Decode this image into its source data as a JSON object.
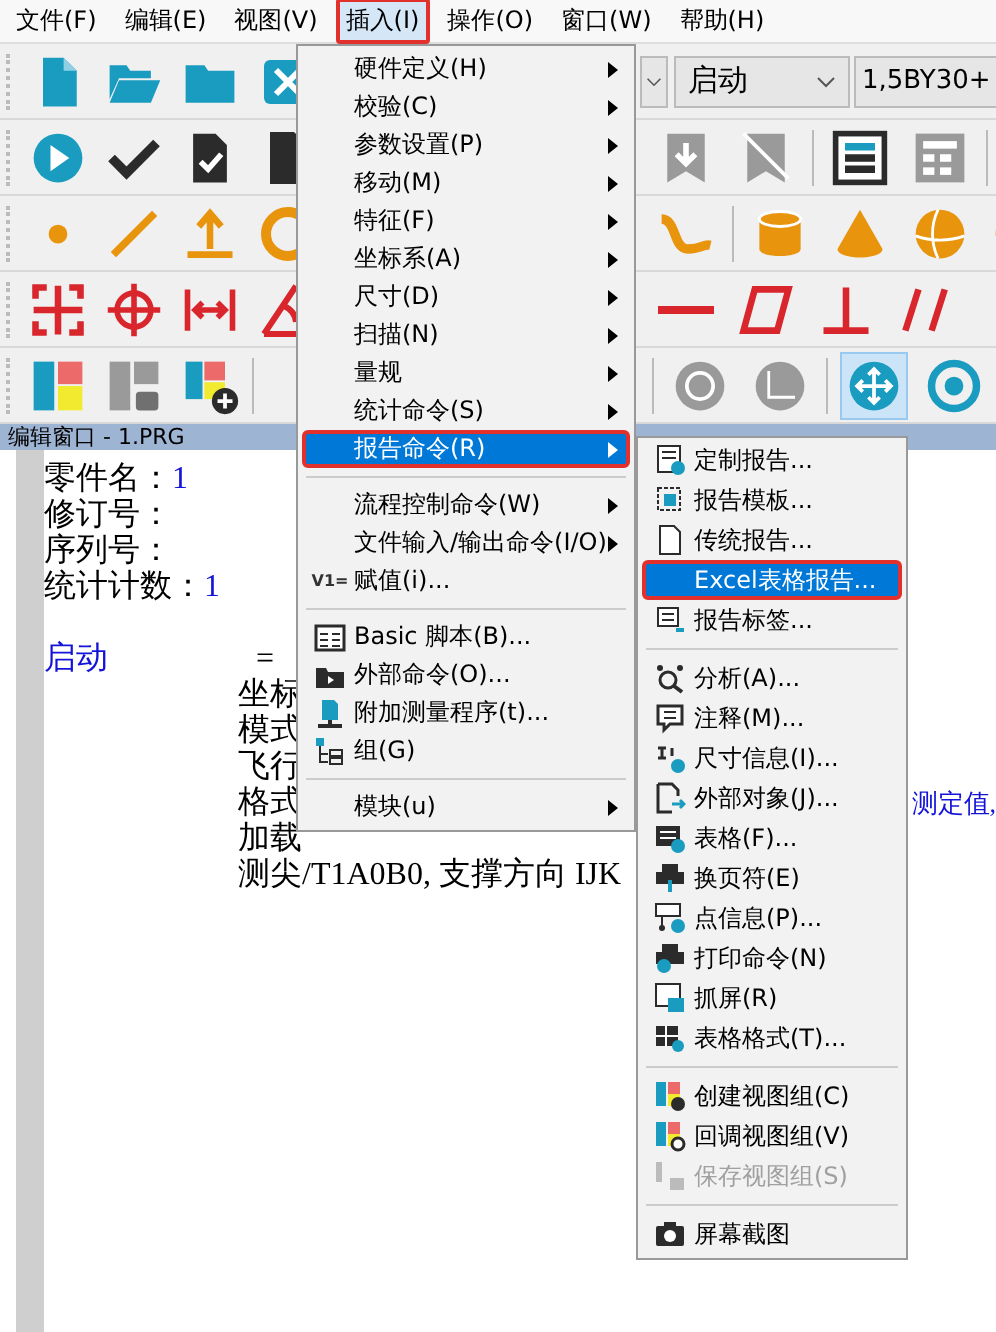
{
  "menubar": [
    {
      "label": "文件(F)",
      "selected": false,
      "outlined": false
    },
    {
      "label": "编辑(E)",
      "selected": false,
      "outlined": false
    },
    {
      "label": "视图(V)",
      "selected": false,
      "outlined": false
    },
    {
      "label": "插入(I)",
      "selected": true,
      "outlined": true
    },
    {
      "label": "操作(O)",
      "selected": false,
      "outlined": false
    },
    {
      "label": "窗口(W)",
      "selected": false,
      "outlined": false
    },
    {
      "label": "帮助(H)",
      "selected": false,
      "outlined": false
    }
  ],
  "toolbar": {
    "combos": [
      {
        "value": "启动"
      },
      {
        "value": "1,5BY30+"
      }
    ]
  },
  "editor": {
    "title": "编辑窗口 - 1.PRG",
    "lines": [
      {
        "kind": "field",
        "label": "零件名：",
        "value": "1"
      },
      {
        "kind": "field",
        "label": "修订号："
      },
      {
        "kind": "field",
        "label": "序列号："
      },
      {
        "kind": "field",
        "label": "统计计数：",
        "value": "1"
      },
      {
        "kind": "blank"
      },
      {
        "kind": "command",
        "name": "启动",
        "text": "="
      },
      {
        "kind": "continuation",
        "text": "坐标"
      },
      {
        "kind": "continuation",
        "text": "模式"
      },
      {
        "kind": "continuation",
        "text": "飞行"
      },
      {
        "kind": "continuation",
        "text": "格式",
        "tail": "测定值,"
      },
      {
        "kind": "continuation",
        "text": "加载"
      },
      {
        "kind": "continuation",
        "text": "测尖/T1A0B0, 支撑方向 IJK"
      }
    ]
  },
  "insert_menu": [
    {
      "kind": "item",
      "label": "硬件定义(H)",
      "submenu": true,
      "selected": false,
      "outlined": false
    },
    {
      "kind": "item",
      "label": "校验(C)",
      "submenu": true,
      "selected": false,
      "outlined": false
    },
    {
      "kind": "item",
      "label": "参数设置(P)",
      "submenu": true,
      "selected": false,
      "outlined": false
    },
    {
      "kind": "item",
      "label": "移动(M)",
      "submenu": true,
      "selected": false,
      "outlined": false
    },
    {
      "kind": "item",
      "label": "特征(F)",
      "submenu": true,
      "selected": false,
      "outlined": false
    },
    {
      "kind": "item",
      "label": "坐标系(A)",
      "submenu": true,
      "selected": false,
      "outlined": false
    },
    {
      "kind": "item",
      "label": "尺寸(D)",
      "submenu": true,
      "selected": false,
      "outlined": false
    },
    {
      "kind": "item",
      "label": "扫描(N)",
      "submenu": true,
      "selected": false,
      "outlined": false
    },
    {
      "kind": "item",
      "label": "量规",
      "submenu": true,
      "selected": false,
      "outlined": false
    },
    {
      "kind": "item",
      "label": "统计命令(S)",
      "submenu": true,
      "selected": false,
      "outlined": false
    },
    {
      "kind": "item",
      "label": "报告命令(R)",
      "submenu": true,
      "selected": true,
      "outlined": true
    },
    {
      "kind": "separator"
    },
    {
      "kind": "item",
      "label": "流程控制命令(W)",
      "submenu": true,
      "selected": false,
      "outlined": false
    },
    {
      "kind": "item",
      "label": "文件输入/输出命令(I/O)",
      "submenu": true,
      "selected": false,
      "outlined": false
    },
    {
      "kind": "item",
      "label": "赋值(i)...",
      "prefix": "V1=",
      "submenu": false,
      "selected": false,
      "outlined": false
    },
    {
      "kind": "separator"
    },
    {
      "kind": "item",
      "label": "Basic 脚本(B)...",
      "submenu": false,
      "selected": false,
      "outlined": false
    },
    {
      "kind": "item",
      "label": "外部命令(O)...",
      "submenu": false,
      "selected": false,
      "outlined": false
    },
    {
      "kind": "item",
      "label": "附加测量程序(t)...",
      "submenu": false,
      "selected": false,
      "outlined": false
    },
    {
      "kind": "item",
      "label": "组(G)",
      "submenu": false,
      "selected": false,
      "outlined": false
    },
    {
      "kind": "separator"
    },
    {
      "kind": "item",
      "label": "模块(u)",
      "submenu": true,
      "selected": false,
      "outlined": false
    }
  ],
  "report_menu": [
    {
      "kind": "item",
      "label": "定制报告...",
      "selected": false,
      "outlined": false,
      "disabled": false
    },
    {
      "kind": "item",
      "label": "报告模板...",
      "selected": false,
      "outlined": false,
      "disabled": false
    },
    {
      "kind": "item",
      "label": "传统报告...",
      "selected": false,
      "outlined": false,
      "disabled": false
    },
    {
      "kind": "item",
      "label": "Excel表格报告...",
      "selected": true,
      "outlined": true,
      "disabled": false
    },
    {
      "kind": "item",
      "label": "报告标签...",
      "selected": false,
      "outlined": false,
      "disabled": false
    },
    {
      "kind": "separator"
    },
    {
      "kind": "item",
      "label": "分析(A)...",
      "selected": false,
      "outlined": false,
      "disabled": false
    },
    {
      "kind": "item",
      "label": "注释(M)...",
      "selected": false,
      "outlined": false,
      "disabled": false
    },
    {
      "kind": "item",
      "label": "尺寸信息(I)...",
      "selected": false,
      "outlined": false,
      "disabled": false
    },
    {
      "kind": "item",
      "label": "外部对象(J)...",
      "selected": false,
      "outlined": false,
      "disabled": false
    },
    {
      "kind": "item",
      "label": "表格(F)...",
      "selected": false,
      "outlined": false,
      "disabled": false
    },
    {
      "kind": "item",
      "label": "换页符(E)",
      "selected": false,
      "outlined": false,
      "disabled": false
    },
    {
      "kind": "item",
      "label": "点信息(P)...",
      "selected": false,
      "outlined": false,
      "disabled": false
    },
    {
      "kind": "item",
      "label": "打印命令(N)",
      "selected": false,
      "outlined": false,
      "disabled": false
    },
    {
      "kind": "item",
      "label": "抓屏(R)",
      "selected": false,
      "outlined": false,
      "disabled": false
    },
    {
      "kind": "item",
      "label": "表格格式(T)...",
      "selected": false,
      "outlined": false,
      "disabled": false
    },
    {
      "kind": "separator"
    },
    {
      "kind": "item",
      "label": "创建视图组(C)",
      "selected": false,
      "outlined": false,
      "disabled": false
    },
    {
      "kind": "item",
      "label": "回调视图组(V)",
      "selected": false,
      "outlined": false,
      "disabled": false
    },
    {
      "kind": "item",
      "label": "保存视图组(S)",
      "selected": false,
      "outlined": false,
      "disabled": true
    },
    {
      "kind": "separator"
    },
    {
      "kind": "item",
      "label": "屏幕截图",
      "selected": false,
      "outlined": false,
      "disabled": false
    }
  ]
}
